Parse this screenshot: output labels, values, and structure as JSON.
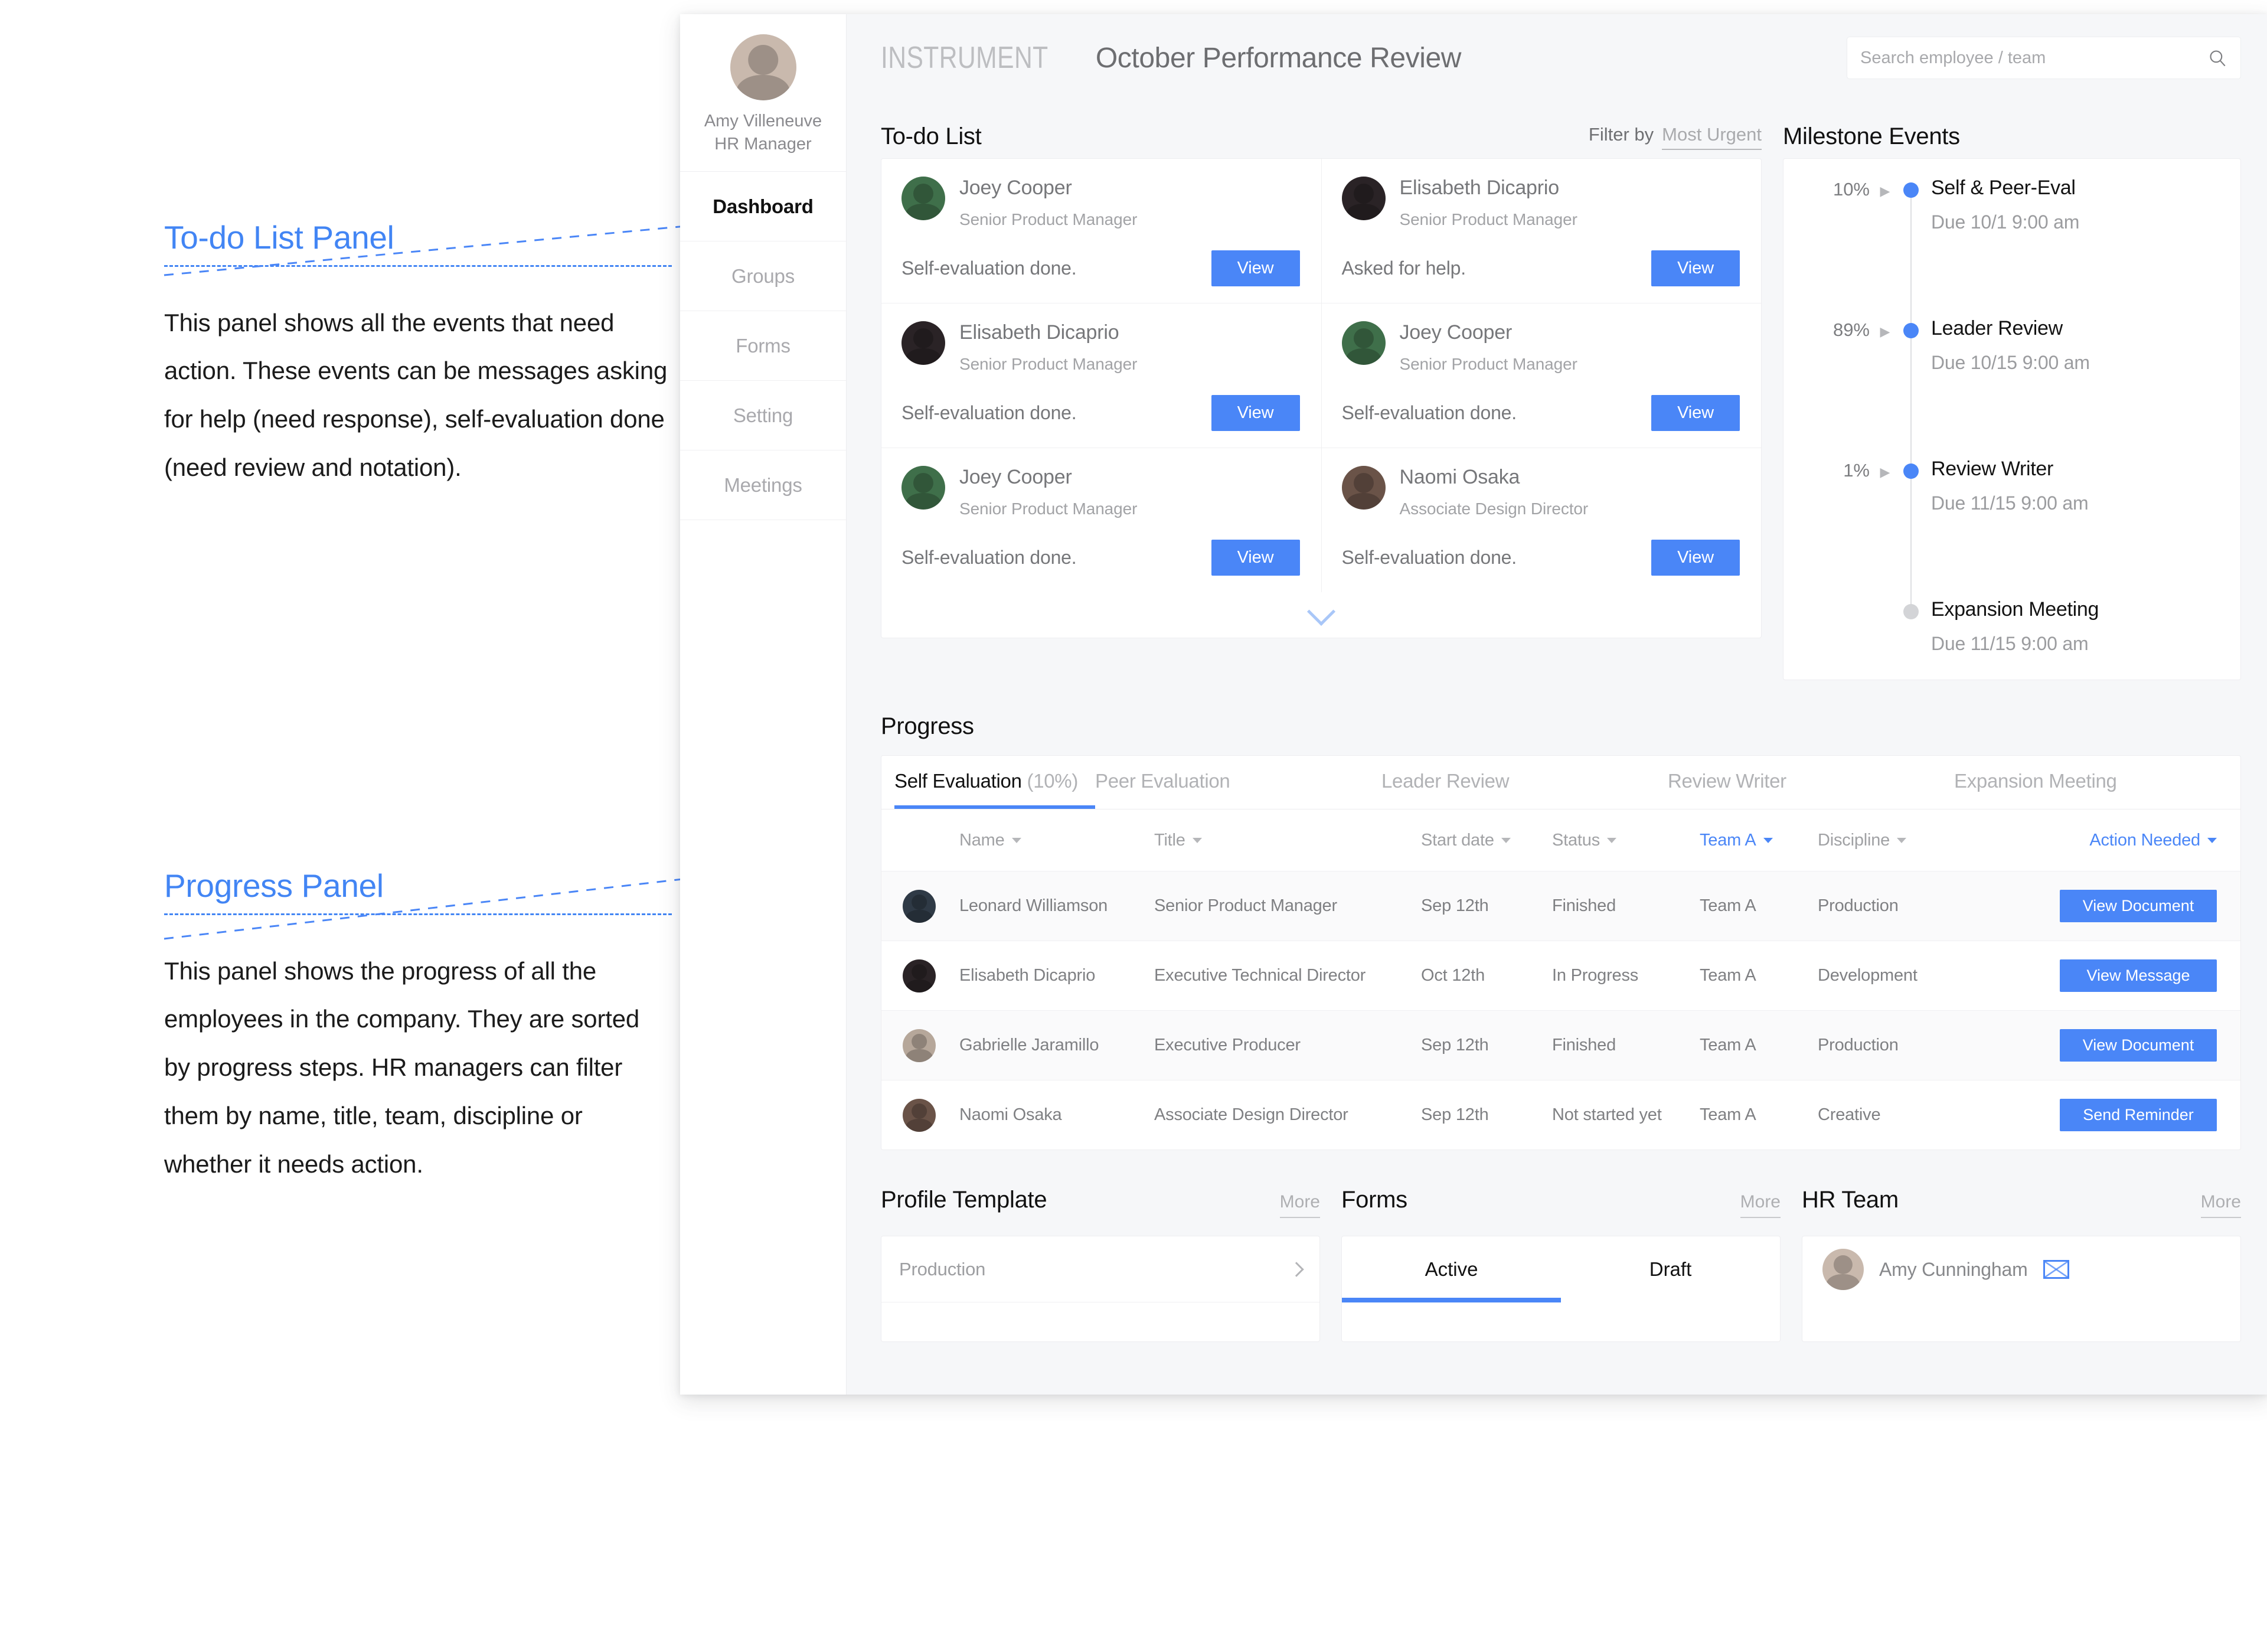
{
  "annotations": [
    {
      "title": "To-do List Panel",
      "body": "This panel shows all the events that need action. These events can be messages asking for help (need response), self-evaluation done (need review and notation)."
    },
    {
      "title": "Progress Panel",
      "body": "This panel shows the progress of all the employees in the company. They are sorted by progress steps. HR managers can filter them by name, title, team, discipline or whether it needs action."
    }
  ],
  "sidebar": {
    "profile": {
      "name": "Amy Villeneuve",
      "role": "HR Manager"
    },
    "items": [
      {
        "label": "Dashboard",
        "active": true
      },
      {
        "label": "Groups",
        "active": false
      },
      {
        "label": "Forms",
        "active": false
      },
      {
        "label": "Setting",
        "active": false
      },
      {
        "label": "Meetings",
        "active": false
      }
    ]
  },
  "topbar": {
    "brand": "INSTRUMENT",
    "title": "October Performance Review",
    "search_placeholder": "Search employee / team",
    "search_value": "",
    "search_icon": "search-icon"
  },
  "todo": {
    "title": "To-do List",
    "filter_label": "Filter by",
    "filter_value": "Most Urgent",
    "expand_icon": "chevron-down-icon",
    "left_items": [
      {
        "name": "Joey Cooper",
        "role": "Senior Product Manager",
        "status": "Self-evaluation done.",
        "button": "View"
      },
      {
        "name": "Elisabeth Dicaprio",
        "role": "Senior Product Manager",
        "status": "Self-evaluation done.",
        "button": "View"
      },
      {
        "name": "Joey Cooper",
        "role": "Senior Product Manager",
        "status": "Self-evaluation done.",
        "button": "View"
      }
    ],
    "right_items": [
      {
        "name": "Elisabeth Dicaprio",
        "role": "Senior Product Manager",
        "status": "Asked for help.",
        "button": "View"
      },
      {
        "name": "Joey Cooper",
        "role": "Senior Product Manager",
        "status": "Self-evaluation done.",
        "button": "View"
      },
      {
        "name": "Naomi Osaka",
        "role": "Associate Design Director",
        "status": "Self-evaluation done.",
        "button": "View"
      }
    ]
  },
  "milestones": {
    "title": "Milestone Events",
    "events": [
      {
        "percent": "10%",
        "name": "Self & Peer-Eval",
        "due": "Due 10/1 9:00 am",
        "active": true
      },
      {
        "percent": "89%",
        "name": "Leader Review",
        "due": "Due 10/15 9:00 am",
        "active": true
      },
      {
        "percent": "1%",
        "name": "Review Writer",
        "due": "Due 11/15 9:00 am",
        "active": true
      },
      {
        "percent": "",
        "name": "Expansion Meeting",
        "due": "Due 11/15 9:00 am",
        "active": false
      }
    ]
  },
  "progress": {
    "title": "Progress",
    "tabs": [
      {
        "label": "Self Evaluation",
        "pct": "(10%)",
        "active": true
      },
      {
        "label": "Peer Evaluation",
        "pct": "",
        "active": false
      },
      {
        "label": "Leader Review",
        "pct": "",
        "active": false
      },
      {
        "label": "Review Writer",
        "pct": "",
        "active": false
      },
      {
        "label": "Expansion Meeting",
        "pct": "",
        "active": false
      }
    ],
    "columns": [
      {
        "label": "Name",
        "highlight": false
      },
      {
        "label": "Title",
        "highlight": false
      },
      {
        "label": "Start date",
        "highlight": false
      },
      {
        "label": "Status",
        "highlight": false
      },
      {
        "label": "Team A",
        "highlight": true
      },
      {
        "label": "Discipline",
        "highlight": false
      },
      {
        "label": "Action Needed",
        "highlight": true
      }
    ],
    "rows": [
      {
        "name": "Leonard Williamson",
        "title": "Senior Product Manager",
        "start": "Sep 12th",
        "status": "Finished",
        "team": "Team A",
        "discipline": "Production",
        "action": "View Document"
      },
      {
        "name": "Elisabeth Dicaprio",
        "title": "Executive Technical Director",
        "start": "Oct 12th",
        "status": "In Progress",
        "team": "Team A",
        "discipline": "Development",
        "action": "View Message"
      },
      {
        "name": "Gabrielle Jaramillo",
        "title": "Executive Producer",
        "start": "Sep 12th",
        "status": "Finished",
        "team": "Team A",
        "discipline": "Production",
        "action": "View Document"
      },
      {
        "name": "Naomi Osaka",
        "title": "Associate Design Director",
        "start": "Sep 12th",
        "status": "Not started yet",
        "team": "Team A",
        "discipline": "Creative",
        "action": "Send Reminder"
      }
    ]
  },
  "bottom": {
    "profile_template": {
      "title": "Profile Template",
      "more": "More",
      "row": "Production",
      "chevron": "chevron-right-icon"
    },
    "forms": {
      "title": "Forms",
      "more": "More",
      "tabs": [
        {
          "label": "Active",
          "active": true
        },
        {
          "label": "Draft",
          "active": false
        }
      ]
    },
    "hr_team": {
      "title": "HR Team",
      "more": "More",
      "member": "Amy Cunningham",
      "mail_icon": "envelope-icon"
    }
  },
  "colors": {
    "accent": "#4a86f7",
    "panel_bg": "#f6f7f9",
    "card_bg": "#ffffff"
  }
}
